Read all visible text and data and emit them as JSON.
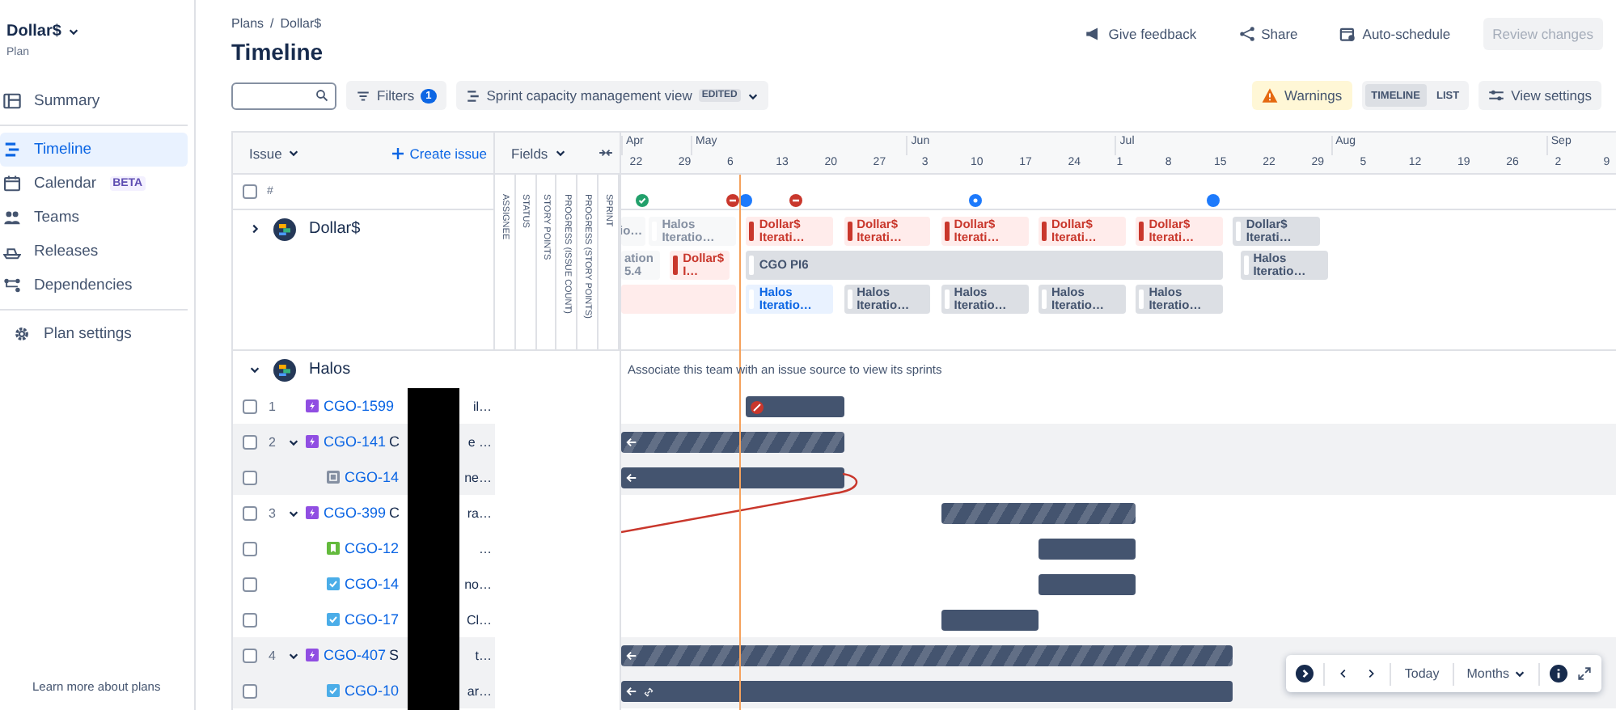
{
  "sidebar": {
    "plan_name": "Dollar$",
    "plan_label": "Plan",
    "items": [
      {
        "label": "Summary",
        "selected": false,
        "divider_after": true
      },
      {
        "label": "Timeline",
        "selected": true
      },
      {
        "label": "Calendar",
        "badge": "BETA",
        "selected": false
      },
      {
        "label": "Teams",
        "selected": false
      },
      {
        "label": "Releases",
        "selected": false
      },
      {
        "label": "Dependencies",
        "selected": false,
        "divider_after": true
      },
      {
        "label": "Plan settings",
        "selected": false
      }
    ],
    "footer_link": "Learn more about plans"
  },
  "breadcrumbs": {
    "items": [
      "Plans",
      "Dollar$"
    ],
    "separator": "/"
  },
  "title": "Timeline",
  "header_actions": [
    {
      "label": "Give feedback",
      "disabled": false
    },
    {
      "label": "Share",
      "disabled": false
    },
    {
      "label": "Auto-schedule",
      "disabled": false
    },
    {
      "label": "Review changes",
      "disabled": true
    }
  ],
  "toolbar": {
    "filters": {
      "label": "Filters",
      "count": "1"
    },
    "view": {
      "label": "Sprint capacity management view",
      "tag": "EDITED"
    },
    "warnings": "Warnings",
    "view_modes": [
      {
        "label": "TIMELINE",
        "selected": true
      },
      {
        "label": "LIST",
        "selected": false
      }
    ],
    "view_settings": "View settings"
  },
  "table": {
    "issue_header": "Issue",
    "create_issue": "Create issue",
    "fields_header": "Fields",
    "number_header": "#",
    "select_all_checked": false,
    "fields": [
      "ASSIGNEE",
      "STATUS",
      "STORY POINTS",
      "PROGRESS (ISSUE COUNT)",
      "PROGRESS (STORY POINTS)",
      "SPRINT"
    ]
  },
  "timeline": {
    "months": [
      "Apr",
      "May",
      "Jun",
      "Jul",
      "Aug",
      "Sep"
    ],
    "weeks": [
      "22",
      "29",
      "6",
      "13",
      "20",
      "27",
      "3",
      "10",
      "17",
      "24",
      "1",
      "8",
      "15",
      "22",
      "29",
      "5",
      "12",
      "19",
      "26",
      "2",
      "9"
    ],
    "markers": [
      {
        "kind": "done"
      },
      {
        "kind": "blocked"
      },
      {
        "kind": "dot"
      },
      {
        "kind": "blocked"
      },
      {
        "kind": "info"
      },
      {
        "kind": "dot"
      }
    ]
  },
  "teams": [
    {
      "name": "Dollar$",
      "expanded": false,
      "sprint_lanes": [
        [
          {
            "label": "io…",
            "kind": "past"
          },
          {
            "label": "Halos Iteratio…",
            "kind": "past"
          },
          {
            "label": "Dollar$ Iterati…",
            "kind": "over"
          },
          {
            "label": "Dollar$ Iterati…",
            "kind": "over"
          },
          {
            "label": "Dollar$ Iterati…",
            "kind": "over"
          },
          {
            "label": "Dollar$ Iterati…",
            "kind": "over"
          },
          {
            "label": "Dollar$ Iterati…",
            "kind": "over"
          },
          {
            "label": "Dollar$ Iterati…",
            "kind": "future"
          }
        ],
        [
          {
            "label": "ation 5.4",
            "kind": "past"
          },
          {
            "label": "Dollar$ I…",
            "kind": "over"
          },
          {
            "label": "CGO PI6",
            "kind": "future"
          },
          {
            "label": "Halos Iteratio…",
            "kind": "future"
          }
        ],
        [
          {
            "kind": "over"
          },
          {
            "label": "Halos Iteratio…",
            "kind": "current"
          },
          {
            "label": "Halos Iteratio…",
            "kind": "future"
          },
          {
            "label": "Halos Iteratio…",
            "kind": "future"
          },
          {
            "label": "Halos Iteratio…",
            "kind": "future"
          },
          {
            "label": "Halos Iteratio…",
            "kind": "future"
          }
        ]
      ]
    },
    {
      "name": "Halos",
      "expanded": true,
      "message": "Associate this team with an issue source to view its sprints",
      "issues": [
        {
          "number": "1",
          "kind": "epic",
          "key": "CGO-1599",
          "tail": "il…",
          "highlighted": false,
          "checked": false,
          "bar": {
            "striped": false,
            "dependency": true
          }
        },
        {
          "number": "2",
          "kind": "epic",
          "key": "CGO-141",
          "head": "C",
          "tail": "e …",
          "expanded": true,
          "highlighted": true,
          "checked": false,
          "bar": {
            "striped": true
          },
          "children": [
            {
              "kind": "subtask",
              "key": "CGO-14",
              "tail": "ne…",
              "highlighted": true,
              "checked": false,
              "bar": {
                "striped": false
              }
            }
          ]
        },
        {
          "number": "3",
          "kind": "epic",
          "key": "CGO-399",
          "head": "C",
          "tail": "ra…",
          "expanded": true,
          "highlighted": false,
          "checked": false,
          "bar": {
            "striped": true
          },
          "children": [
            {
              "kind": "story",
              "key": "CGO-12",
              "tail": "…",
              "highlighted": false,
              "checked": false,
              "bar": {
                "striped": false
              }
            },
            {
              "kind": "task",
              "key": "CGO-14",
              "tail": "no…",
              "highlighted": false,
              "checked": false,
              "bar": {
                "striped": false
              }
            },
            {
              "kind": "task",
              "key": "CGO-17",
              "tail": "Cl…",
              "highlighted": false,
              "checked": false,
              "bar": {
                "striped": false
              }
            }
          ]
        },
        {
          "number": "4",
          "kind": "epic",
          "key": "CGO-407",
          "head": "S",
          "tail": "t…",
          "expanded": true,
          "highlighted": true,
          "checked": false,
          "bar": {
            "striped": true
          },
          "children": [
            {
              "kind": "task",
              "key": "CGO-10",
              "tail": "ar…",
              "highlighted": true,
              "checked": false,
              "bar": {
                "striped": false,
                "linked": true
              }
            }
          ]
        }
      ]
    }
  ],
  "navigator": {
    "today": "Today",
    "scale": "Months"
  }
}
